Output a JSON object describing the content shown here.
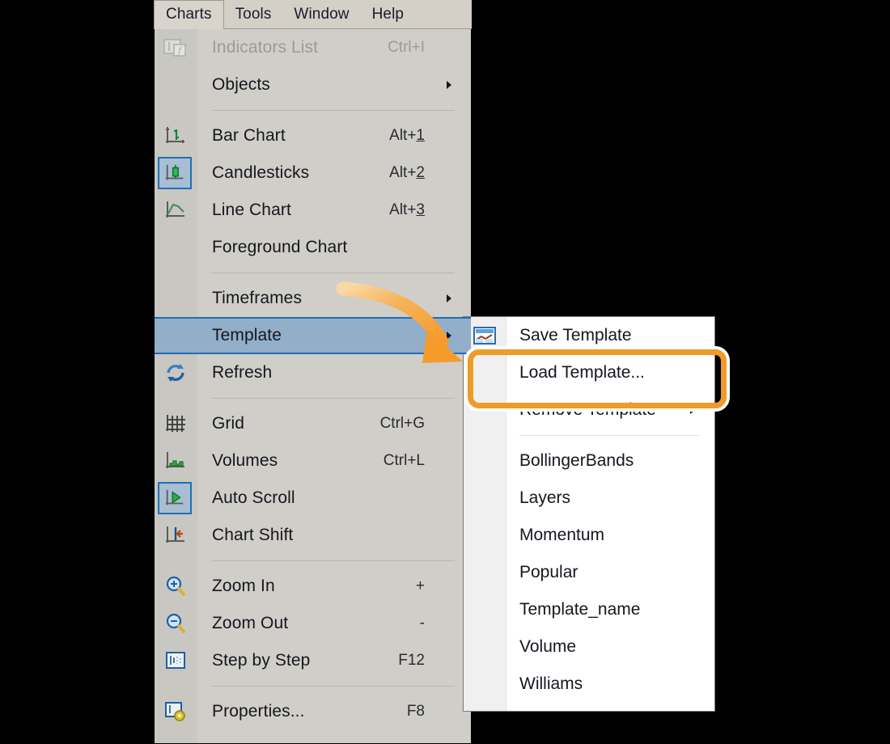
{
  "menubar": {
    "items": [
      {
        "label": "Charts",
        "active": true
      },
      {
        "label": "Tools",
        "active": false
      },
      {
        "label": "Window",
        "active": false
      },
      {
        "label": "Help",
        "active": false
      }
    ]
  },
  "charts_menu": {
    "items": [
      {
        "label": "Indicators List",
        "accel": "Ctrl+I",
        "icon": "indicators-list-icon",
        "disabled": true,
        "submenu": false,
        "selected": false
      },
      {
        "label": "Objects",
        "accel": "",
        "icon": "",
        "disabled": false,
        "submenu": true,
        "selected": false
      },
      {
        "label": "Bar Chart",
        "accel": "Alt+1",
        "accel_underline": "1",
        "icon": "bar-chart-icon",
        "disabled": false,
        "submenu": false,
        "selected": false
      },
      {
        "label": "Candlesticks",
        "accel": "Alt+2",
        "accel_underline": "2",
        "icon": "candlestick-chart-icon",
        "disabled": false,
        "submenu": false,
        "selected": true
      },
      {
        "label": "Line Chart",
        "accel": "Alt+3",
        "accel_underline": "3",
        "icon": "line-chart-icon",
        "disabled": false,
        "submenu": false,
        "selected": false
      },
      {
        "label": "Foreground Chart",
        "accel": "",
        "icon": "",
        "disabled": false,
        "submenu": false,
        "selected": false
      },
      {
        "label": "Timeframes",
        "accel": "",
        "icon": "",
        "disabled": false,
        "submenu": true,
        "selected": false
      },
      {
        "label": "Template",
        "accel": "",
        "icon": "",
        "disabled": false,
        "submenu": true,
        "selected": false,
        "highlighted": true
      },
      {
        "label": "Refresh",
        "accel": "",
        "icon": "refresh-icon",
        "disabled": false,
        "submenu": false,
        "selected": false
      },
      {
        "label": "Grid",
        "accel": "Ctrl+G",
        "icon": "grid-icon",
        "disabled": false,
        "submenu": false,
        "selected": false
      },
      {
        "label": "Volumes",
        "accel": "Ctrl+L",
        "icon": "volumes-icon",
        "disabled": false,
        "submenu": false,
        "selected": false
      },
      {
        "label": "Auto Scroll",
        "accel": "",
        "icon": "auto-scroll-icon",
        "disabled": false,
        "submenu": false,
        "selected": true
      },
      {
        "label": "Chart Shift",
        "accel": "",
        "icon": "chart-shift-icon",
        "disabled": false,
        "submenu": false,
        "selected": false
      },
      {
        "label": "Zoom In",
        "accel": "+",
        "icon": "zoom-in-icon",
        "disabled": false,
        "submenu": false,
        "selected": false
      },
      {
        "label": "Zoom Out",
        "accel": "-",
        "icon": "zoom-out-icon",
        "disabled": false,
        "submenu": false,
        "selected": false
      },
      {
        "label": "Step by Step",
        "accel": "F12",
        "icon": "step-by-step-icon",
        "disabled": false,
        "submenu": false,
        "selected": false
      },
      {
        "label": "Properties...",
        "accel": "F8",
        "icon": "properties-icon",
        "disabled": false,
        "submenu": false,
        "selected": false
      }
    ]
  },
  "template_submenu": {
    "items": [
      {
        "label": "Save Template",
        "icon": "save-template-icon",
        "submenu": false
      },
      {
        "label": "Load Template...",
        "icon": "",
        "submenu": false,
        "annotated": true
      },
      {
        "label": "Remove Template",
        "icon": "",
        "submenu": true
      },
      {
        "label": "BollingerBands",
        "icon": "",
        "submenu": false
      },
      {
        "label": "Layers",
        "icon": "",
        "submenu": false
      },
      {
        "label": "Momentum",
        "icon": "",
        "submenu": false
      },
      {
        "label": "Popular",
        "icon": "",
        "submenu": false
      },
      {
        "label": "Template_name",
        "icon": "",
        "submenu": false
      },
      {
        "label": "Volume",
        "icon": "",
        "submenu": false
      },
      {
        "label": "Williams",
        "icon": "",
        "submenu": false
      }
    ]
  },
  "annotation": {
    "highlight_color": "#f09a28",
    "highlight_target": "Load Template...",
    "arrow_from": "Template",
    "arrow_to": "Load Template..."
  },
  "colors": {
    "menu_background": "#d0cec8",
    "gutter": "#c9c7c1",
    "submenu_background": "#ffffff",
    "highlight_row": "#92aec8",
    "highlight_border": "#1f6fb5",
    "accent_orange": "#f09a28",
    "page_background": "#000000"
  }
}
